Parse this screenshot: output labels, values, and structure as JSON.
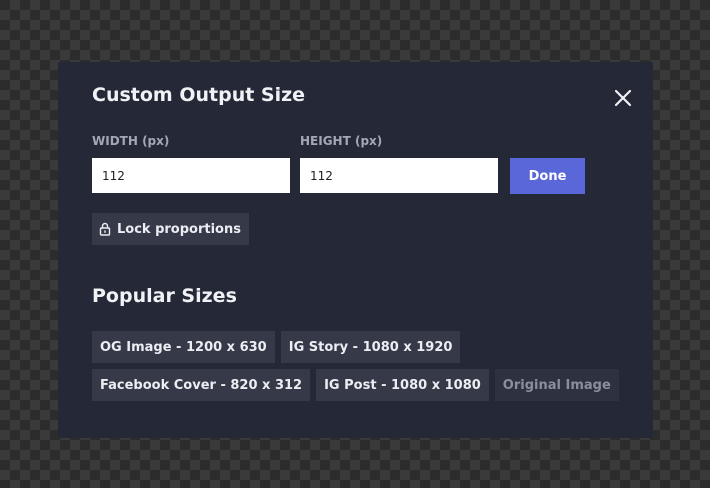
{
  "dialog": {
    "title": "Custom Output Size"
  },
  "fields": {
    "width_label": "WIDTH (px)",
    "width_value": "112",
    "height_label": "HEIGHT (px)",
    "height_value": "112"
  },
  "buttons": {
    "done_label": "Done",
    "lock_label": "Lock proportions"
  },
  "popular": {
    "title": "Popular Sizes",
    "sizes": [
      "OG Image - 1200 x 630",
      "IG Story - 1080 x 1920",
      "Facebook Cover - 820 x 312",
      "IG Post - 1080 x 1080",
      "Original Image"
    ]
  },
  "icons": {
    "close": "close-icon",
    "lock": "lock-icon"
  },
  "colors": {
    "modal_background": "#252836",
    "accent": "#5a67d8",
    "chip_background": "#353948",
    "muted_text": "#8b8f9d"
  }
}
